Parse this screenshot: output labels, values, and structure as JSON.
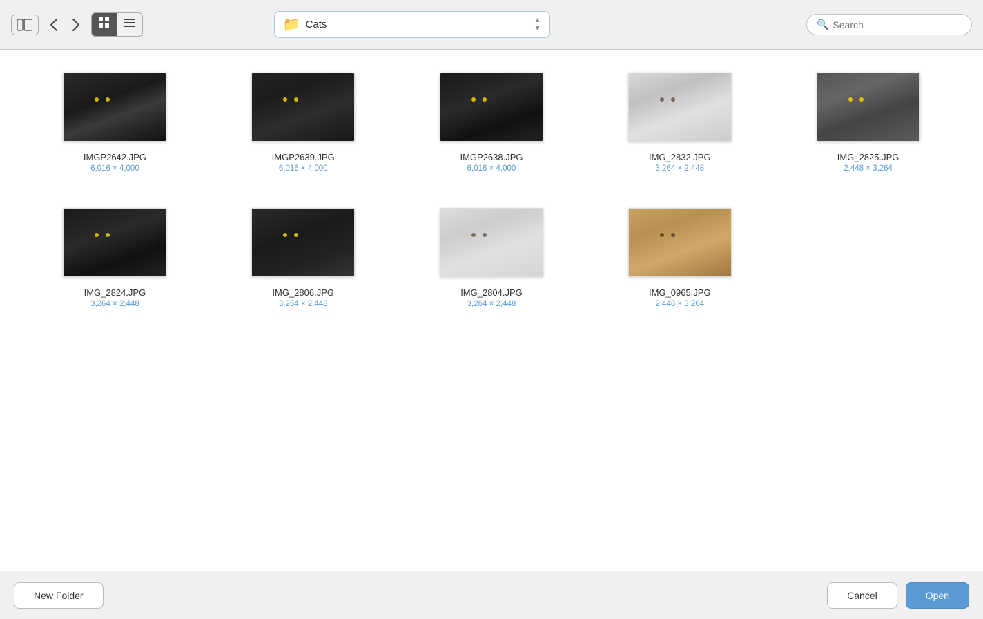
{
  "toolbar": {
    "sidebar_toggle_icon": "▪▪",
    "back_icon": "‹",
    "forward_icon": "›",
    "grid_view_icon": "⊞",
    "list_view_icon": "≡",
    "location": "Cats",
    "search_placeholder": "Search"
  },
  "files": [
    {
      "id": 1,
      "name": "IMGP2642.JPG",
      "dims": "6,016 × 4,000",
      "cat_class": "cat-1"
    },
    {
      "id": 2,
      "name": "IMGP2639.JPG",
      "dims": "6,016 × 4,000",
      "cat_class": "cat-2"
    },
    {
      "id": 3,
      "name": "IMGP2638.JPG",
      "dims": "6,016 × 4,000",
      "cat_class": "cat-3"
    },
    {
      "id": 4,
      "name": "IMG_2832.JPG",
      "dims": "3,264 × 2,448",
      "cat_class": "cat-4"
    },
    {
      "id": 5,
      "name": "IMG_2825.JPG",
      "dims": "2,448 × 3,264",
      "cat_class": "cat-5"
    },
    {
      "id": 6,
      "name": "IMG_2824.JPG",
      "dims": "3,264 × 2,448",
      "cat_class": "cat-6"
    },
    {
      "id": 7,
      "name": "IMG_2806.JPG",
      "dims": "3,264 × 2,448",
      "cat_class": "cat-7"
    },
    {
      "id": 8,
      "name": "IMG_2804.JPG",
      "dims": "3,264 × 2,448",
      "cat_class": "cat-8"
    },
    {
      "id": 9,
      "name": "IMG_0965.JPG",
      "dims": "2,448 × 3,264",
      "cat_class": "cat-9"
    }
  ],
  "buttons": {
    "new_folder": "New Folder",
    "cancel": "Cancel",
    "open": "Open"
  }
}
